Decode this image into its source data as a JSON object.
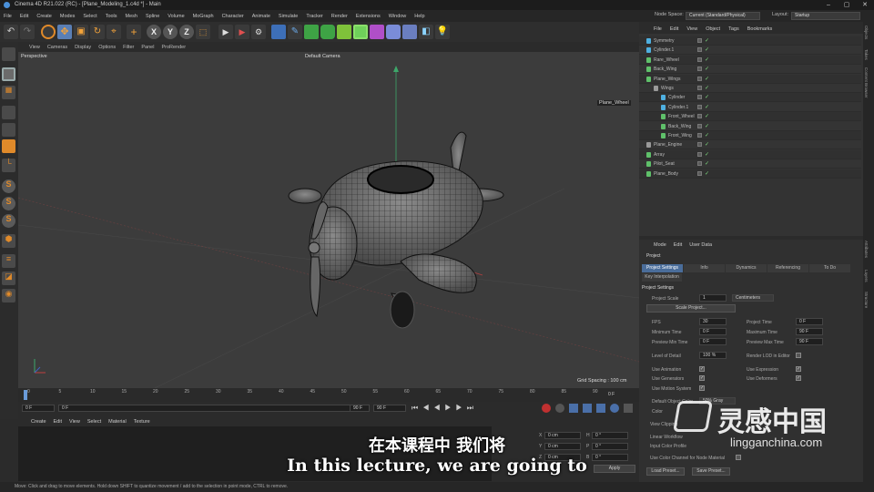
{
  "window": {
    "title": "Cinema 4D R21.022 (RC) - [Plane_Modeling_1.c4d *] - Main"
  },
  "menubar": [
    "File",
    "Edit",
    "Create",
    "Modes",
    "Select",
    "Tools",
    "Mesh",
    "Spline",
    "Volume",
    "MoGraph",
    "Character",
    "Animate",
    "Simulate",
    "Tracker",
    "Render",
    "Extensions",
    "Window",
    "Help"
  ],
  "node_space": {
    "label": "Node Space:",
    "value": "Current (Standard/Physical)"
  },
  "layout": {
    "label": "Layout:",
    "value": "Startup"
  },
  "viewport": {
    "menu": [
      "View",
      "Cameras",
      "Display",
      "Options",
      "Filter",
      "Panel",
      "ProRender"
    ],
    "perspective": "Perspective",
    "camera": "Default Camera",
    "tooltip": "Plane_Wheel",
    "grid_spacing": "Grid Spacing : 100 cm"
  },
  "timeline": {
    "ticks": [
      "0",
      "5",
      "10",
      "15",
      "20",
      "25",
      "30",
      "35",
      "40",
      "45",
      "50",
      "55",
      "60",
      "65",
      "70",
      "75",
      "80",
      "85",
      "90"
    ],
    "end_label": "0 F",
    "current": "0 F",
    "start": "0 F",
    "min": "90 F",
    "max": "90 F"
  },
  "material_menu": [
    "Create",
    "Edit",
    "View",
    "Select",
    "Material",
    "Texture"
  ],
  "coords": {
    "rows": [
      {
        "a": "X",
        "v1": "0 cm",
        "b": "H",
        "v2": "0 °"
      },
      {
        "a": "Y",
        "v1": "0 cm",
        "b": "P",
        "v2": "0 °"
      },
      {
        "a": "Z",
        "v1": "0 cm",
        "b": "B",
        "v2": "0 °"
      }
    ],
    "apply": "Apply"
  },
  "object_manager": {
    "menu": [
      "File",
      "Edit",
      "View",
      "Object",
      "Tags",
      "Bookmarks"
    ],
    "items": [
      {
        "name": "Symmetry",
        "indent": 0,
        "color": "#4fb0e0"
      },
      {
        "name": "Cylinder.1",
        "indent": 0,
        "color": "#4fb0e0"
      },
      {
        "name": "Rare_Wheel",
        "indent": 0,
        "color": "#5fc06a"
      },
      {
        "name": "Back_Wing",
        "indent": 0,
        "color": "#5fc06a"
      },
      {
        "name": "Plane_Wings",
        "indent": 0,
        "color": "#5fc06a"
      },
      {
        "name": "Wings",
        "indent": 1,
        "color": "#9a9a9a"
      },
      {
        "name": "Cylinder",
        "indent": 2,
        "color": "#4fb0e0"
      },
      {
        "name": "Cylinder.1",
        "indent": 2,
        "color": "#4fb0e0"
      },
      {
        "name": "Front_Wheel",
        "indent": 2,
        "color": "#5fc06a"
      },
      {
        "name": "Back_Wing",
        "indent": 2,
        "color": "#5fc06a"
      },
      {
        "name": "Front_Wing",
        "indent": 2,
        "color": "#5fc06a"
      },
      {
        "name": "Plane_Engine",
        "indent": 0,
        "color": "#9a9a9a"
      },
      {
        "name": "Array",
        "indent": 0,
        "color": "#5fc06a"
      },
      {
        "name": "Pilot_Seat",
        "indent": 0,
        "color": "#5fc06a"
      },
      {
        "name": "Plane_Body",
        "indent": 0,
        "color": "#5fc06a"
      }
    ]
  },
  "right_tabs": [
    "Objects",
    "Takes",
    "Content Browser",
    "Attributes",
    "Layers",
    "Structure"
  ],
  "attributes": {
    "menu": [
      "Mode",
      "Edit",
      "User Data"
    ],
    "header": "Project",
    "tabs": [
      "Project Settings",
      "Info",
      "Dynamics",
      "Referencing",
      "To Do"
    ],
    "key_interp": "Key Interpolation",
    "section": "Project Settings",
    "project_scale_label": "Project Scale",
    "project_scale": "1",
    "unit": "Centimeters",
    "scale_btn": "Scale Project...",
    "fps_label": "FPS",
    "fps": "30",
    "project_time_label": "Project Time",
    "project_time": "0 F",
    "min_time_label": "Minimum Time",
    "min_time": "0 F",
    "max_time_label": "Maximum Time",
    "max_time": "90 F",
    "prev_min_label": "Preview Min Time",
    "prev_min": "0 F",
    "prev_max_label": "Preview Max Time",
    "prev_max": "90 F",
    "lod_label": "Level of Detail",
    "lod": "100 %",
    "render_lod": "Render LOD in Editor",
    "use_anim": "Use Animation",
    "use_expr": "Use Expression",
    "use_gen": "Use Generators",
    "use_def": "Use Deformers",
    "use_motion": "Use Motion System",
    "default_color_label": "Default Object Color",
    "default_color": "50% Gray",
    "color_label": "Color",
    "view_clipping": "View Clipping",
    "linear_workflow": "Linear Workflow",
    "input_color": "Input Color Profile",
    "use_color_channel": "Use Color Channel for Node Material",
    "load_preset": "Load Preset...",
    "save_preset": "Save Preset..."
  },
  "status": "Move: Click and drag to move elements. Hold down SHIFT to quantize movement / add to the selection in point mode, CTRL to remove.",
  "subtitle": {
    "zh": "在本课程中 我们将",
    "en": "In this lecture, we are going to"
  },
  "watermark": {
    "brand": "灵感中国",
    "url": "lingganchina.com"
  }
}
